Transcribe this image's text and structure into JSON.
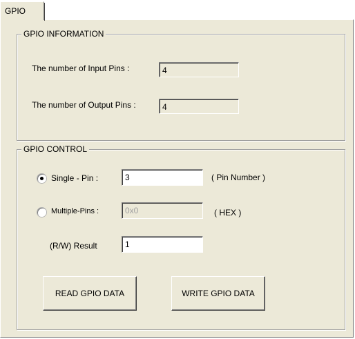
{
  "tabs": [
    {
      "label": "GPIO",
      "selected": true
    }
  ],
  "info_group": {
    "title": "GPIO INFORMATION",
    "input_pins_label": "The number of Input  Pins :",
    "input_pins_value": "4",
    "output_pins_label": "The number of Output Pins :",
    "output_pins_value": "4"
  },
  "control_group": {
    "title": "GPIO CONTROL",
    "single_pin": {
      "label": "Single - Pin :",
      "value": "3",
      "hint": "( Pin Number )",
      "selected": true
    },
    "multiple_pins": {
      "label": "Multiple-Pins :",
      "value": "0x0",
      "hint": "( HEX )",
      "selected": false,
      "disabled": true
    },
    "result": {
      "label": "(R/W) Result",
      "value": "1"
    },
    "read_button_label": "READ GPIO DATA",
    "write_button_label": "WRITE GPIO DATA"
  },
  "colors": {
    "panel_bg": "#ece9d8",
    "field_bg": "#ffffff",
    "disabled_text": "#a0a0a0"
  }
}
